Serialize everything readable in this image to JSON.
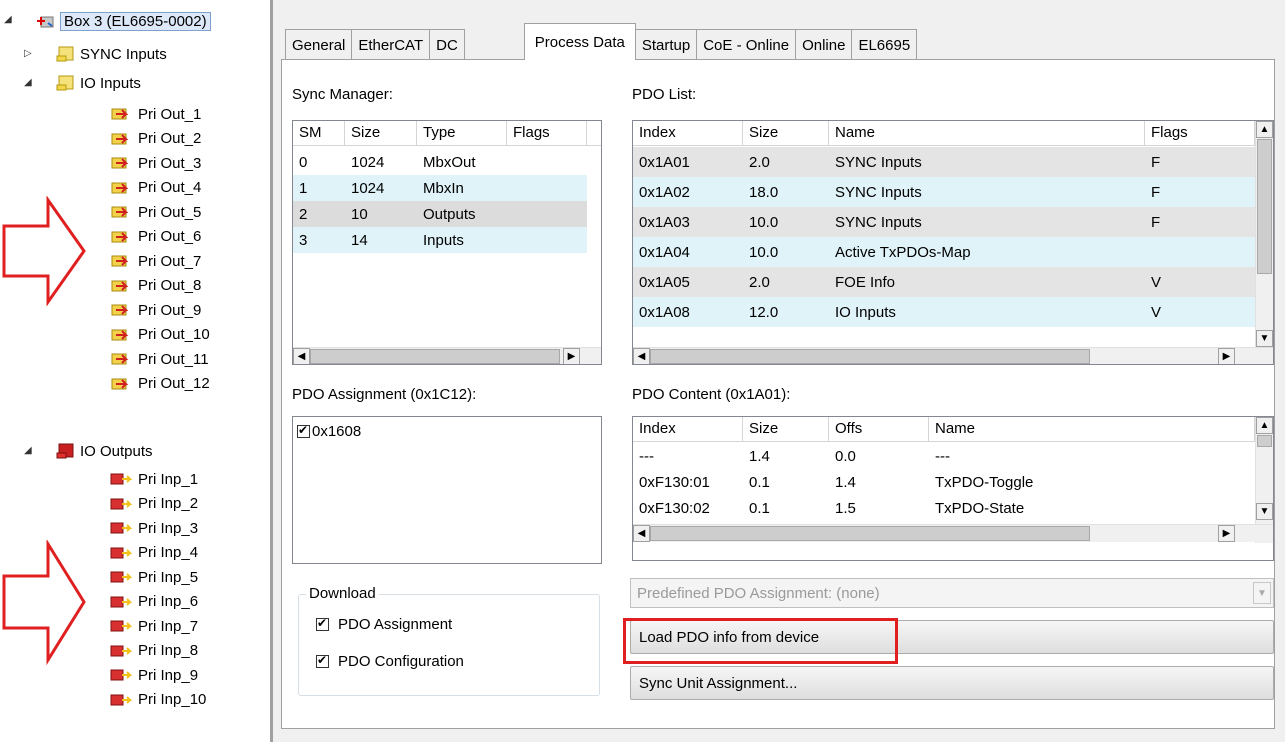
{
  "tree": {
    "root": {
      "label": "Box 3 (EL6695-0002)"
    },
    "sync_inputs": {
      "label": "SYNC Inputs"
    },
    "io_inputs": {
      "label": "IO Inputs",
      "items": [
        "Pri Out_1",
        "Pri Out_2",
        "Pri Out_3",
        "Pri Out_4",
        "Pri Out_5",
        "Pri Out_6",
        "Pri Out_7",
        "Pri Out_8",
        "Pri Out_9",
        "Pri Out_10",
        "Pri Out_11",
        "Pri Out_12"
      ]
    },
    "io_outputs": {
      "label": "IO Outputs",
      "items": [
        "Pri Inp_1",
        "Pri Inp_2",
        "Pri Inp_3",
        "Pri Inp_4",
        "Pri Inp_5",
        "Pri Inp_6",
        "Pri Inp_7",
        "Pri Inp_8",
        "Pri Inp_9",
        "Pri Inp_10"
      ]
    }
  },
  "tabs": [
    "General",
    "EtherCAT",
    "DC",
    "Process Data",
    "Startup",
    "CoE - Online",
    "Online",
    "EL6695"
  ],
  "active_tab": "Process Data",
  "sync_manager": {
    "label": "Sync Manager:",
    "columns": [
      "SM",
      "Size",
      "Type",
      "Flags"
    ],
    "rows": [
      [
        "0",
        "1024",
        "MbxOut",
        ""
      ],
      [
        "1",
        "1024",
        "MbxIn",
        ""
      ],
      [
        "2",
        "10",
        "Outputs",
        ""
      ],
      [
        "3",
        "14",
        "Inputs",
        ""
      ]
    ]
  },
  "pdo_list": {
    "label": "PDO List:",
    "columns": [
      "Index",
      "Size",
      "Name",
      "Flags"
    ],
    "rows": [
      [
        "0x1A01",
        "2.0",
        "SYNC Inputs",
        "F"
      ],
      [
        "0x1A02",
        "18.0",
        "SYNC Inputs",
        "F"
      ],
      [
        "0x1A03",
        "10.0",
        "SYNC Inputs",
        "F"
      ],
      [
        "0x1A04",
        "10.0",
        "Active TxPDOs-Map",
        ""
      ],
      [
        "0x1A05",
        "2.0",
        "FOE Info",
        "V"
      ],
      [
        "0x1A08",
        "12.0",
        "IO Inputs",
        "V"
      ]
    ]
  },
  "pdo_assignment": {
    "label": "PDO Assignment (0x1C12):",
    "items": [
      {
        "label": "0x1608",
        "checked": true
      }
    ]
  },
  "pdo_content": {
    "label": "PDO Content (0x1A01):",
    "columns": [
      "Index",
      "Size",
      "Offs",
      "Name"
    ],
    "rows": [
      [
        "---",
        "1.4",
        "0.0",
        "---"
      ],
      [
        "0xF130:01",
        "0.1",
        "1.4",
        "TxPDO-Toggle"
      ],
      [
        "0xF130:02",
        "0.1",
        "1.5",
        "TxPDO-State"
      ]
    ]
  },
  "download": {
    "label": "Download",
    "pdo_assignment": {
      "label": "PDO Assignment",
      "checked": true
    },
    "pdo_configuration": {
      "label": "PDO Configuration",
      "checked": true
    }
  },
  "predefined": {
    "placeholder": "Predefined PDO Assignment: (none)"
  },
  "buttons": {
    "load": "Load PDO info from device",
    "sync_unit": "Sync Unit Assignment..."
  },
  "colors": {
    "highlight": "#e02020",
    "arrow": "#e02020",
    "row_alt": "#dff3f8",
    "row_gray": "#e4e4e4"
  }
}
